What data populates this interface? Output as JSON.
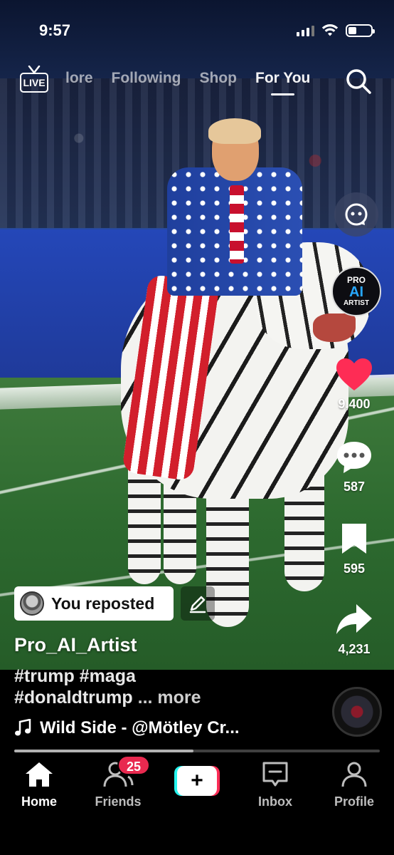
{
  "status_bar": {
    "time": "9:57"
  },
  "top_nav": {
    "live_label": "LIVE",
    "tabs": [
      {
        "label": "lore"
      },
      {
        "label": "Following"
      },
      {
        "label": "Shop"
      },
      {
        "label": "For You"
      }
    ],
    "active_tab": "For You"
  },
  "right_rail": {
    "avatar": {
      "line1": "PRO",
      "line2": "AI",
      "line3": "ARTIST"
    },
    "likes": "9,400",
    "comments": "587",
    "saves": "595",
    "shares": "4,231"
  },
  "post": {
    "repost_label": "You reposted",
    "username": "Pro_AI_Artist",
    "caption_line1": "#trump #maga",
    "caption_line2": "#donaldtrump",
    "caption_more": "... more",
    "music": "Wild Side - @Mötley Cr...",
    "progress": 0.49
  },
  "bottom_nav": {
    "home": "Home",
    "friends": "Friends",
    "friends_badge": "25",
    "create": "+",
    "inbox": "Inbox",
    "profile": "Profile",
    "active": "Home"
  },
  "colors": {
    "like_red": "#fe2c55",
    "badge_red": "#e8294f",
    "create_cyan": "#25f4ee",
    "create_pink": "#fe2c55"
  }
}
